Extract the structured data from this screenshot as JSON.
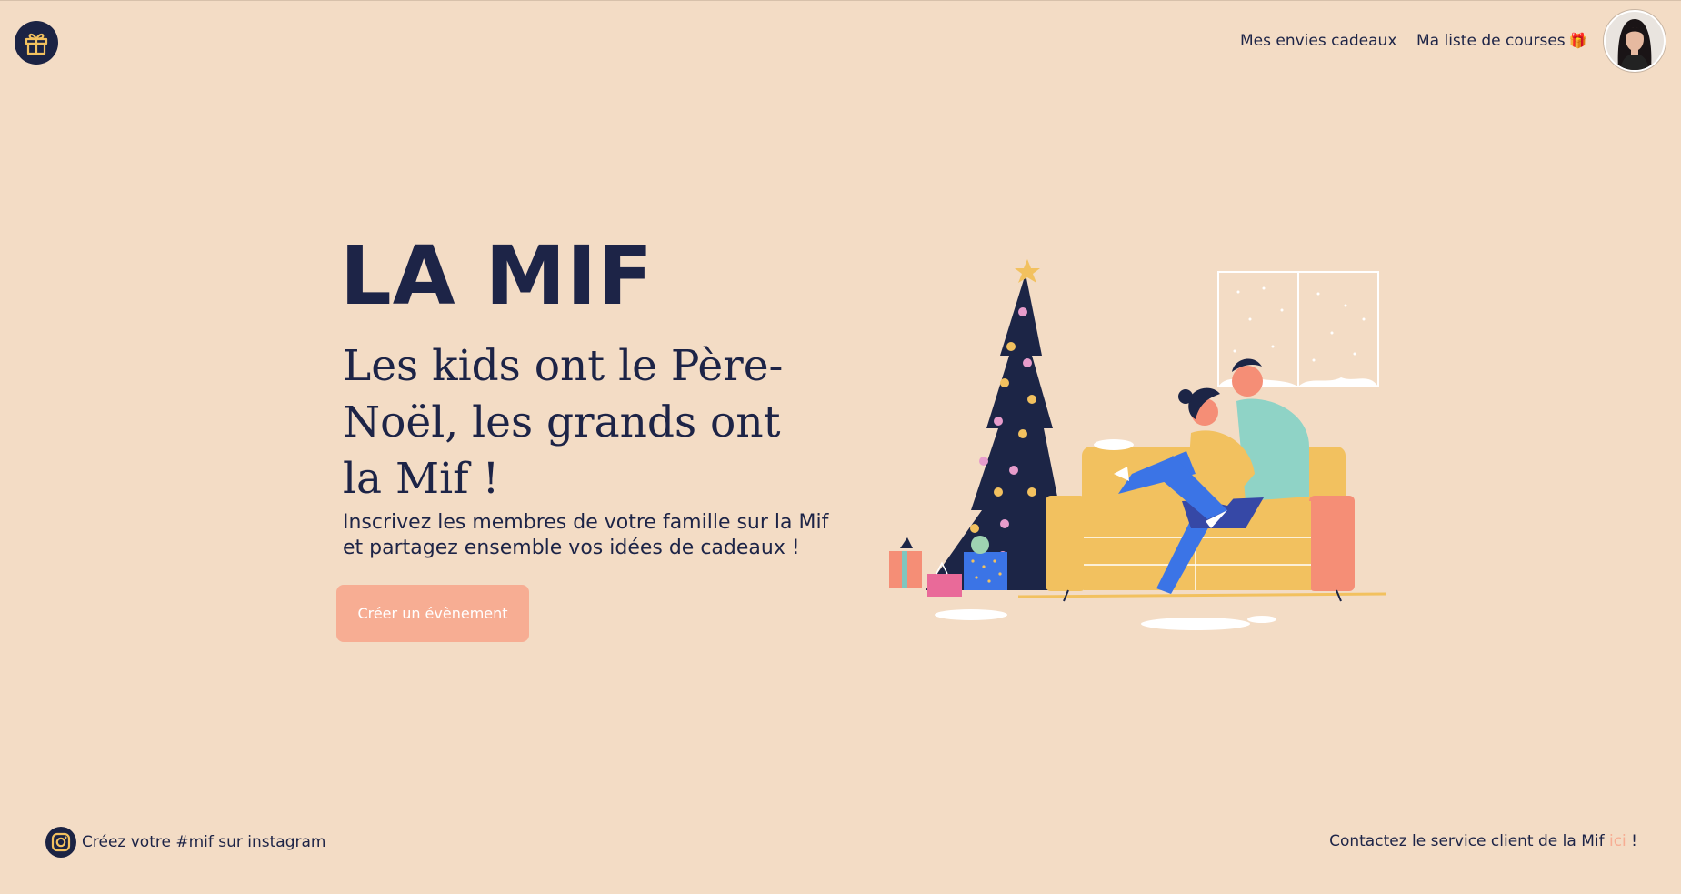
{
  "header": {
    "logo_icon": "gift-icon",
    "nav": {
      "envies_label": "Mes envies cadeaux",
      "courses_label": "Ma liste de courses",
      "courses_emoji": "🎁"
    },
    "avatar_icon": "user-avatar"
  },
  "hero": {
    "title": "LA MIF",
    "tagline": "Les kids ont le Père-Noël, les grands ont la Mif !",
    "description": "Inscrivez les membres de votre famille sur la Mif et partagez ensemble vos idées de cadeaux !",
    "cta_label": "Créer un évènement"
  },
  "footer": {
    "instagram_icon": "instagram-icon",
    "instagram_text": "Créez votre #mif sur instagram",
    "contact_prefix": "Contactez le service client de la Mif ",
    "contact_link": "ici",
    "contact_suffix": " !"
  },
  "colors": {
    "background": "#f3dcc5",
    "navy": "#1d2447",
    "accent": "#f7ad93"
  }
}
